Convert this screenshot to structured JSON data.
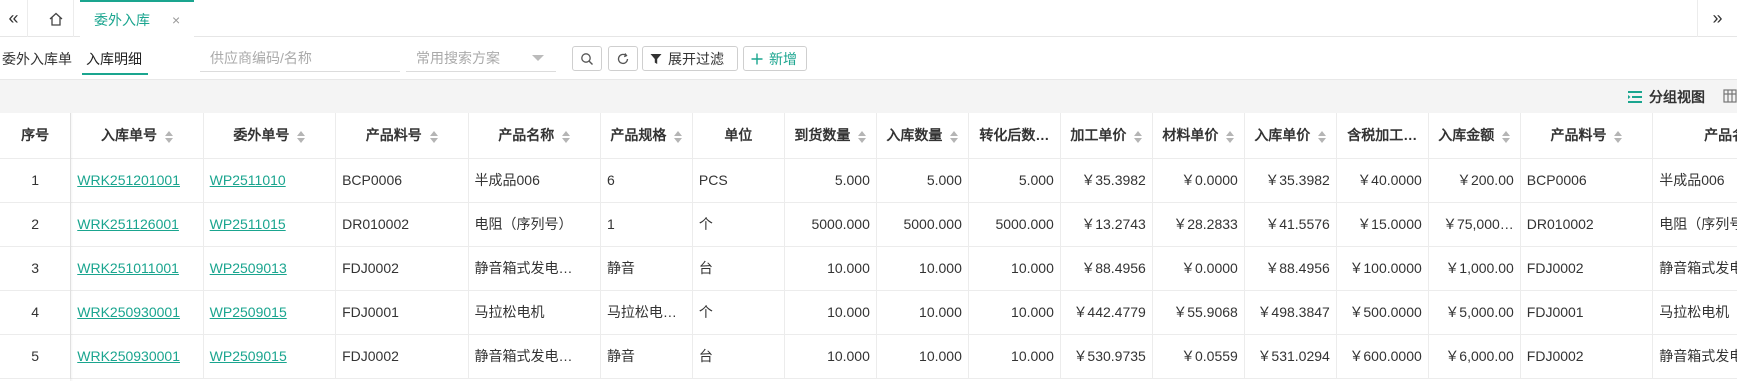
{
  "tabs": {
    "active_tab": "委外入库"
  },
  "filters": {
    "subtab_1": "委外入库单",
    "subtab_2": "入库明细",
    "supplier_placeholder": "供应商编码/名称",
    "scheme_placeholder": "常用搜索方案",
    "expand_filter_label": "展开过滤",
    "add_label": "新增"
  },
  "toolbar": {
    "group_view_label": "分组视图"
  },
  "table": {
    "columns": [
      {
        "key": "idx",
        "label": "序号",
        "sortable": false
      },
      {
        "key": "in_no",
        "label": "入库单号",
        "sortable": true
      },
      {
        "key": "out_no",
        "label": "委外单号",
        "sortable": true
      },
      {
        "key": "code",
        "label": "产品料号",
        "sortable": true
      },
      {
        "key": "name",
        "label": "产品名称",
        "sortable": true
      },
      {
        "key": "spec",
        "label": "产品规格",
        "sortable": true
      },
      {
        "key": "unit",
        "label": "单位",
        "sortable": false
      },
      {
        "key": "arr_qty",
        "label": "到货数量",
        "sortable": true
      },
      {
        "key": "in_qty",
        "label": "入库数量",
        "sortable": true
      },
      {
        "key": "conv_qty",
        "label": "转化后数…",
        "sortable": false
      },
      {
        "key": "proc_price",
        "label": "加工单价",
        "sortable": true
      },
      {
        "key": "mat_price",
        "label": "材料单价",
        "sortable": true
      },
      {
        "key": "in_price",
        "label": "入库单价",
        "sortable": true
      },
      {
        "key": "tax_proc",
        "label": "含税加工…",
        "sortable": false
      },
      {
        "key": "amount",
        "label": "入库金额",
        "sortable": true
      },
      {
        "key": "code2",
        "label": "产品料号",
        "sortable": true
      },
      {
        "key": "name2",
        "label": "产品名称",
        "sortable": false
      }
    ],
    "rows": [
      {
        "idx": "1",
        "in_no": "WRK251201001",
        "out_no": "WP2511010",
        "code": "BCP0006",
        "name": "半成品006",
        "spec": "6",
        "unit": "PCS",
        "arr_qty": "5.000",
        "in_qty": "5.000",
        "conv_qty": "5.000",
        "proc_price": "￥35.3982",
        "mat_price": "￥0.0000",
        "in_price": "￥35.3982",
        "tax_proc": "￥40.0000",
        "amount": "￥200.00",
        "code2": "BCP0006",
        "name2": "半成品006"
      },
      {
        "idx": "2",
        "in_no": "WRK251126001",
        "out_no": "WP2511015",
        "code": "DR010002",
        "name": "电阻（序列号）",
        "spec": "1",
        "unit": "个",
        "arr_qty": "5000.000",
        "in_qty": "5000.000",
        "conv_qty": "5000.000",
        "proc_price": "￥13.2743",
        "mat_price": "￥28.2833",
        "in_price": "￥41.5576",
        "tax_proc": "￥15.0000",
        "amount": "￥75,000…",
        "code2": "DR010002",
        "name2": "电阻（序列号）"
      },
      {
        "idx": "3",
        "in_no": "WRK251011001",
        "out_no": "WP2509013",
        "code": "FDJ0002",
        "name": "静音箱式发电…",
        "spec": "静音",
        "unit": "台",
        "arr_qty": "10.000",
        "in_qty": "10.000",
        "conv_qty": "10.000",
        "proc_price": "￥88.4956",
        "mat_price": "￥0.0000",
        "in_price": "￥88.4956",
        "tax_proc": "￥100.0000",
        "amount": "￥1,000.00",
        "code2": "FDJ0002",
        "name2": "静音箱式发电机"
      },
      {
        "idx": "4",
        "in_no": "WRK250930001",
        "out_no": "WP2509015",
        "code": "FDJ0001",
        "name": "马拉松电机",
        "spec": "马拉松电…",
        "unit": "个",
        "arr_qty": "10.000",
        "in_qty": "10.000",
        "conv_qty": "10.000",
        "proc_price": "￥442.4779",
        "mat_price": "￥55.9068",
        "in_price": "￥498.3847",
        "tax_proc": "￥500.0000",
        "amount": "￥5,000.00",
        "code2": "FDJ0001",
        "name2": "马拉松电机"
      },
      {
        "idx": "5",
        "in_no": "WRK250930001",
        "out_no": "WP2509015",
        "code": "FDJ0002",
        "name": "静音箱式发电…",
        "spec": "静音",
        "unit": "台",
        "arr_qty": "10.000",
        "in_qty": "10.000",
        "conv_qty": "10.000",
        "proc_price": "￥530.9735",
        "mat_price": "￥0.0559",
        "in_price": "￥531.0294",
        "tax_proc": "￥600.0000",
        "amount": "￥6,000.00",
        "code2": "FDJ0002",
        "name2": "静音箱式发电机"
      }
    ]
  },
  "colors": {
    "accent": "#1aa58f",
    "border": "#ececec",
    "toolbar_bg": "#f4f4f4"
  }
}
